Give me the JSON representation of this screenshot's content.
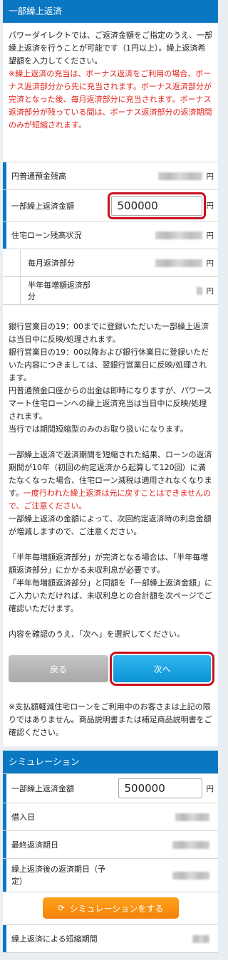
{
  "repayment": {
    "title": "一部繰上返済",
    "intro": "パワーダイレクトでは、ご返済金額をご指定のうえ、一部繰上返済を行うことが可能です（1円以上）。繰上返済希望額を入力してください。",
    "intro_note": "※繰上返済の充当は、ボーナス返済をご利用の場合、ボーナス返済部分から先に充当されます。ボーナス返済部分が完済となった後、毎月返済部分に充当されます。ボーナス返済部分が残っている間は、ボーナス返済部分の返済期間のみが短縮されます。",
    "rows": {
      "savings_balance": {
        "label": "円普通預金残高",
        "unit": "円"
      },
      "amount": {
        "label": "一部繰上返済金額",
        "value": "500000",
        "unit": "円"
      },
      "loan_balance": {
        "label": "住宅ローン残高状況",
        "unit": "円"
      },
      "monthly": {
        "label": "毎月返済部分",
        "unit": "円"
      },
      "bonus": {
        "label": "半年毎増額返済部分",
        "unit": "円"
      }
    },
    "notes": {
      "p1": "銀行営業日の19：00までに登録いただいた一部繰上返済は当日中に反映/処理されます。",
      "p2": "銀行営業日の19：00以降および銀行休業日に登録いただいた内容につきましては、翌銀行営業日に反映/処理されます。",
      "p3": "円普通預金口座からの出金は即時になりますが、パワースマート住宅ローンへの繰上返済充当は当日中に反映/処理されます。",
      "p4": "当行では期間短縮型のみのお取り扱いになります。",
      "p5": "一部繰上返済で返済期間を短縮された結果、ローンの返済期間が10年（初回の約定返済から起算して120回）に満たなくなった場合、住宅ローン減税は適用されなくなります。",
      "p5_red": "一度行われた繰上返済は元に戻すことはできませんので、ご注意ください。",
      "p6": "一部繰上返済の金額によって、次回約定返済時の利息金額が増減しますので、ご注意ください。",
      "p7": "「半年毎増額返済部分」が完済となる場合は、「半年毎増額返済部分」にかかる未収利息が必要です。",
      "p8": "「半年毎増額返済部分」と同額を「一部繰上返済金額」にご入力いただければ、未収利息との合計額を次ページでご確認いただけます。",
      "p9": "内容を確認のうえ、「次へ」を選択してください。"
    },
    "back_label": "戻る",
    "next_label": "次へ",
    "after_note": "※支払額軽減住宅ローンをご利用中のお客さまは上記の限りではありません。商品説明書または補足商品説明書をご確認ください。"
  },
  "simulation": {
    "title": "シミュレーション",
    "amount_label": "一部繰上返済金額",
    "amount_value": "500000",
    "amount_unit": "円",
    "borrow_date_label": "借入日",
    "last_date_label": "最終返済期日",
    "after_date_label": "繰上返済後の返済期日（予定）",
    "button_label": "シミュレーションをする",
    "shortened_label": "繰上返済による短縮期間"
  }
}
